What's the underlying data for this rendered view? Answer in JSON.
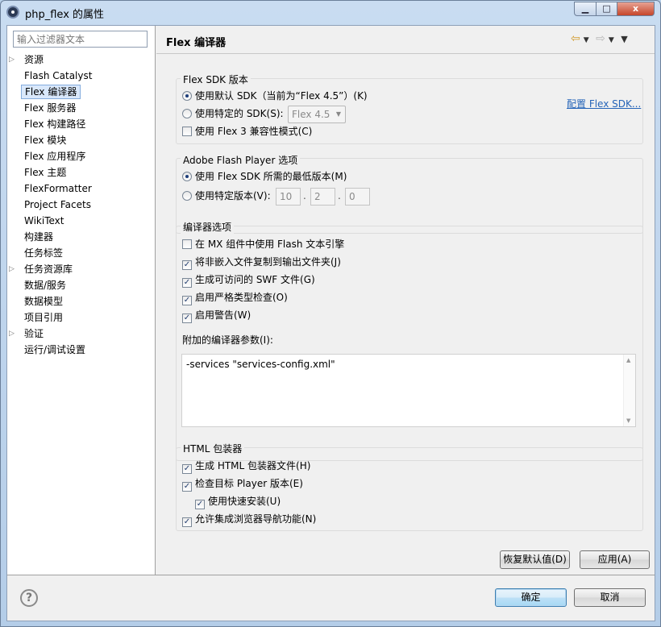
{
  "window": {
    "title": "php_flex 的属性",
    "minimize_label": "▁",
    "maximize_label": "□",
    "close_label": "x"
  },
  "sidebar": {
    "filter_placeholder": "输入过滤器文本",
    "items": [
      {
        "label": "资源",
        "expandable": true
      },
      {
        "label": "Flash Catalyst"
      },
      {
        "label": "Flex 编译器",
        "selected": true
      },
      {
        "label": "Flex 服务器"
      },
      {
        "label": "Flex 构建路径"
      },
      {
        "label": "Flex 模块"
      },
      {
        "label": "Flex 应用程序"
      },
      {
        "label": "Flex 主题"
      },
      {
        "label": "FlexFormatter"
      },
      {
        "label": "Project Facets"
      },
      {
        "label": "WikiText"
      },
      {
        "label": "构建器"
      },
      {
        "label": "任务标签"
      },
      {
        "label": "任务资源库",
        "expandable": true
      },
      {
        "label": "数据/服务"
      },
      {
        "label": "数据模型"
      },
      {
        "label": "项目引用"
      },
      {
        "label": "验证",
        "expandable": true
      },
      {
        "label": "运行/调试设置"
      }
    ]
  },
  "page": {
    "title": "Flex 编译器",
    "nav_icons": [
      "back-arrow-icon",
      "forward-arrow-icon",
      "view-menu-icon"
    ]
  },
  "sdk_group": {
    "title": "Flex SDK 版本",
    "use_default": {
      "label": "使用默认 SDK（当前为“Flex 4.5”）(K)",
      "checked": true
    },
    "use_specific": {
      "label": "使用特定的 SDK(S):",
      "checked": false,
      "combo_value": "Flex 4.5"
    },
    "compat": {
      "label": "使用 Flex 3 兼容性模式(C)",
      "checked": false
    },
    "configure_link": "配置 Flex SDK..."
  },
  "player_group": {
    "title": "Adobe Flash Player 选项",
    "min_version": {
      "label": "使用 Flex SDK 所需的最低版本(M)",
      "checked": true
    },
    "specific_version": {
      "label": "使用特定版本(V):",
      "checked": false
    },
    "version": {
      "major": "10",
      "minor": "2",
      "revision": "0",
      "separator": "."
    }
  },
  "compiler_group": {
    "title": "编译器选项",
    "options": [
      {
        "label": "在 MX 组件中使用 Flash 文本引擎",
        "checked": false
      },
      {
        "label": "将非嵌入文件复制到输出文件夹(J)",
        "checked": true
      },
      {
        "label": "生成可访问的 SWF 文件(G)",
        "checked": true
      },
      {
        "label": "启用严格类型检查(O)",
        "checked": true
      },
      {
        "label": "启用警告(W)",
        "checked": true
      }
    ],
    "args_label": "附加的编译器参数(I):",
    "args_value": "-services \"services-config.xml\""
  },
  "html_group": {
    "title": "HTML 包装器",
    "options": [
      {
        "label": "生成 HTML 包装器文件(H)",
        "checked": true
      },
      {
        "label": "检查目标 Player 版本(E)",
        "checked": true
      },
      {
        "label": "使用快速安装(U)",
        "checked": true
      },
      {
        "label": "允许集成浏览器导航功能(N)",
        "checked": true
      }
    ]
  },
  "buttons": {
    "restore_defaults": "恢复默认值(D)",
    "apply": "应用(A)",
    "ok": "确定",
    "cancel": "取消",
    "help": "?"
  },
  "glyphs": {
    "check": "✓",
    "combo_arrow": "▼",
    "tree_arrow": "▷",
    "scroll_up": "▲",
    "scroll_down": "▼"
  }
}
